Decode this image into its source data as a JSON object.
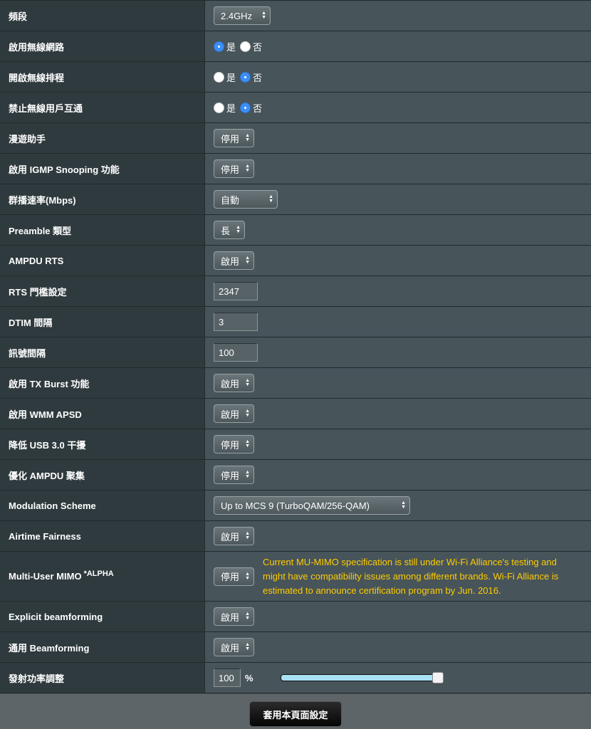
{
  "rows": {
    "band": {
      "label": "頻段",
      "value": "2.4GHz"
    },
    "enable_radio": {
      "label": "啟用無線網路",
      "yes": "是",
      "no": "否",
      "selected": "yes"
    },
    "enable_schedule": {
      "label": "開啟無線排程",
      "yes": "是",
      "no": "否",
      "selected": "no"
    },
    "ap_isolate": {
      "label": "禁止無線用戶互通",
      "yes": "是",
      "no": "否",
      "selected": "no"
    },
    "roaming_assist": {
      "label": "漫遊助手",
      "value": "停用"
    },
    "igmp_snooping": {
      "label": "啟用 IGMP Snooping 功能",
      "value": "停用"
    },
    "multicast_rate": {
      "label": "群播速率(Mbps)",
      "value": "自動"
    },
    "preamble": {
      "label": "Preamble 類型",
      "value": "長"
    },
    "ampdu_rts": {
      "label": "AMPDU RTS",
      "value": "啟用"
    },
    "rts_threshold": {
      "label": "RTS 門檻設定",
      "value": "2347"
    },
    "dtim": {
      "label": "DTIM 間隔",
      "value": "3"
    },
    "beacon": {
      "label": "訊號間隔",
      "value": "100"
    },
    "tx_burst": {
      "label": "啟用 TX Burst 功能",
      "value": "啟用"
    },
    "wmm_apsd": {
      "label": "啟用 WMM APSD",
      "value": "啟用"
    },
    "usb3_interference": {
      "label": "降低 USB 3.0 干擾",
      "value": "停用"
    },
    "ampdu_aggregation": {
      "label": "優化 AMPDU 聚集",
      "value": "停用"
    },
    "modulation": {
      "label": "Modulation Scheme",
      "value": "Up to MCS 9 (TurboQAM/256-QAM)"
    },
    "airtime_fairness": {
      "label": "Airtime Fairness",
      "value": "啟用"
    },
    "mu_mimo": {
      "label": "Multi-User MIMO",
      "label_sup": "*ALPHA",
      "value": "停用",
      "note": "Current MU-MIMO specification is still under Wi-Fi Alliance's testing and might have compatibility issues among different brands. Wi-Fi Alliance is estimated to announce certification program by Jun. 2016."
    },
    "explicit_bf": {
      "label": "Explicit beamforming",
      "value": "啟用"
    },
    "universal_bf": {
      "label": "通用 Beamforming",
      "value": "啟用"
    },
    "tx_power": {
      "label": "發射功率調整",
      "value": "100",
      "unit": "%",
      "slider_fraction": 1.0
    }
  },
  "footer": {
    "apply_label": "套用本頁面設定"
  },
  "colors": {
    "accent_radio": "#3d8ef5",
    "note_text": "#ffcc00",
    "slider_fill": "#a8e2f5"
  }
}
